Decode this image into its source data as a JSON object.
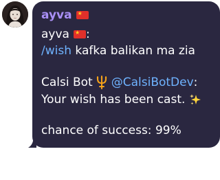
{
  "message": {
    "sender": "ayva",
    "sender_flag": "red-flag-icon",
    "quoted_sender": "ayva",
    "quoted_colon": ":",
    "command": "/wish",
    "command_text": " kafka balikan ma zia",
    "bot_name": "Calsi Bot",
    "bot_icon": "trident-icon",
    "bot_handle": "@CalsiBotDev",
    "bot_colon": ":",
    "reply_line": "Your wish has been cast.",
    "reply_icon": "sparkles-icon",
    "chance_line": "chance of success: 99%"
  },
  "colors": {
    "bubble": "#2a2740",
    "sender": "#a98ff5",
    "link": "#6fb3ff",
    "text": "#ffffff"
  }
}
